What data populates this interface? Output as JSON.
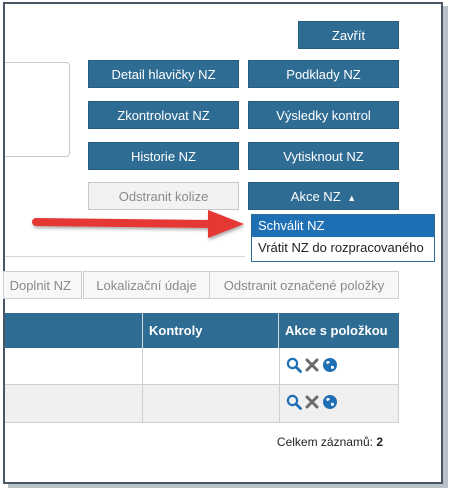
{
  "header": {
    "close_label": "Zavřít"
  },
  "actions": {
    "detail_header": "Detail hlavičky NZ",
    "documents": "Podklady NZ",
    "check": "Zkontrolovat NZ",
    "check_results": "Výsledky kontrol",
    "history": "Historie NZ",
    "print": "Vytisknout NZ",
    "remove_conflicts": "Odstranit kolize",
    "actions_dropdown": "Akce NZ",
    "actions_caret": "▲"
  },
  "dropdown_menu": {
    "items": [
      {
        "label": "Schválit NZ"
      },
      {
        "label": "Vrátit NZ do rozpracovaného"
      }
    ]
  },
  "toolbar": {
    "tabs": [
      {
        "label": "Doplnit NZ"
      },
      {
        "label": "Lokalizační údaje"
      },
      {
        "label": "Odstranit označené položky"
      }
    ]
  },
  "table": {
    "columns": [
      "",
      "Kontroly",
      "Akce s položkou"
    ],
    "row_icons": [
      "search-icon",
      "remove-icon",
      "globe-icon"
    ],
    "rows": [
      {
        "cells": [
          "",
          ""
        ]
      },
      {
        "cells": [
          "",
          ""
        ]
      }
    ]
  },
  "footer": {
    "total_label": "Celkem záznamů:",
    "total_value": "2"
  },
  "colors": {
    "primary": "#2f6c94",
    "menu_highlight": "#1f6fb5",
    "arrow": "#e53935"
  }
}
